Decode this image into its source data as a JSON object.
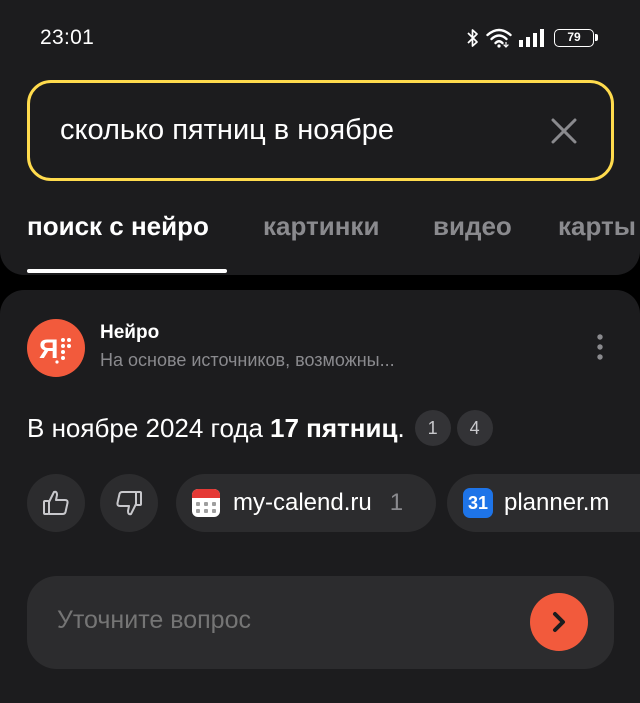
{
  "status_bar": {
    "time": "23:01",
    "battery": "79",
    "icons": [
      "bluetooth-icon",
      "wifi-icon",
      "signal-icon",
      "battery-icon"
    ]
  },
  "search": {
    "query": "сколько пятниц в ноябре",
    "accent": "#ffdb4d"
  },
  "tabs": [
    {
      "label": "поиск с нейро",
      "active": true
    },
    {
      "label": "картинки",
      "active": false
    },
    {
      "label": "видео",
      "active": false
    },
    {
      "label": "карты",
      "active": false
    }
  ],
  "answer_card": {
    "source_name": "Нейро",
    "source_subtitle": "На основе источников, возможны...",
    "answer_prefix": "В ноябре 2024 года",
    "answer_bold": "17 пятниц",
    "answer_suffix": ".",
    "refs": [
      "1",
      "4"
    ],
    "sources": [
      {
        "name": "my-calend.ru",
        "count": "1",
        "icon": "calendar-favicon"
      },
      {
        "name": "planner.m",
        "icon": "calendar-31-favicon"
      }
    ],
    "brand_color": "#f25a3c"
  },
  "followup": {
    "placeholder": "Уточните вопрос"
  }
}
